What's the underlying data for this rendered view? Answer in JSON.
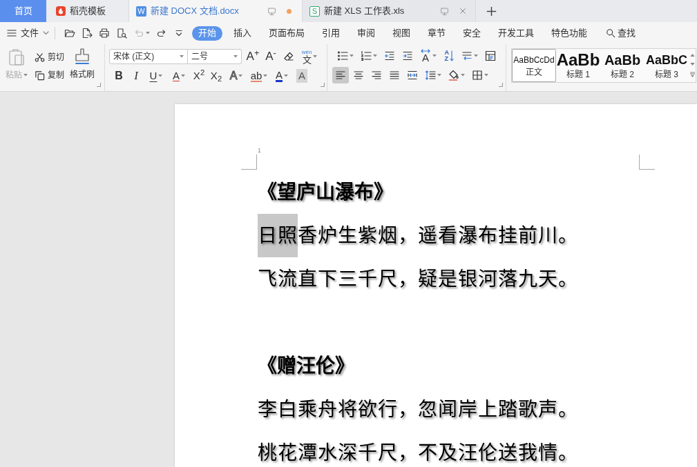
{
  "tabs": [
    {
      "label": "首页",
      "kind": "home",
      "selected": false
    },
    {
      "label": "稻壳模板",
      "kind": "template",
      "selected": false
    },
    {
      "label": "新建 DOCX 文档.docx",
      "kind": "document",
      "badge": "W",
      "selected": true,
      "modified": true
    },
    {
      "label": "新建 XLS 工作表.xls",
      "kind": "sheet",
      "badge": "S",
      "selected": false,
      "modified": false
    }
  ],
  "menu": {
    "file": "文件",
    "quick_access": [
      {
        "kind": "open",
        "disabled": false
      },
      {
        "kind": "pdf",
        "disabled": false
      },
      {
        "kind": "print",
        "disabled": false
      },
      {
        "kind": "preview",
        "disabled": false
      },
      {
        "kind": "undo",
        "disabled": true,
        "dropdown": true
      },
      {
        "kind": "redo",
        "disabled": false
      },
      {
        "kind": "customize",
        "disabled": false
      }
    ],
    "ribbon_tabs": [
      {
        "label": "开始",
        "selected": true
      },
      {
        "label": "插入",
        "selected": false
      },
      {
        "label": "页面布局",
        "selected": false
      },
      {
        "label": "引用",
        "selected": false
      },
      {
        "label": "审阅",
        "selected": false
      },
      {
        "label": "视图",
        "selected": false
      },
      {
        "label": "章节",
        "selected": false
      },
      {
        "label": "安全",
        "selected": false
      },
      {
        "label": "开发工具",
        "selected": false
      },
      {
        "label": "特色功能",
        "selected": false
      }
    ],
    "find": "查找"
  },
  "clipboard": {
    "paste": {
      "label": "粘贴",
      "disabled": true
    },
    "cut": {
      "label": "剪切"
    },
    "copy": {
      "label": "复制"
    },
    "format_painter": {
      "label": "格式刷"
    }
  },
  "font": {
    "family": "宋体 (正文)",
    "size": "二号",
    "row1": [
      {
        "kind": "grow",
        "glyph": "A$^{+}$"
      },
      {
        "kind": "shrink",
        "glyph": "A$^{-}$"
      },
      {
        "kind": "clear"
      },
      {
        "kind": "pinyin",
        "glyph": "文",
        "ruby": "wén",
        "dropdown": true
      }
    ],
    "row2": [
      {
        "kind": "bold",
        "glyph": "B"
      },
      {
        "kind": "italic",
        "glyph": "I"
      },
      {
        "kind": "underline",
        "glyph": "U",
        "dropdown": true
      },
      {
        "kind": "strike",
        "glyph": "A",
        "dropdown": true
      },
      {
        "kind": "superscript",
        "glyph": "X$^{2}$"
      },
      {
        "kind": "subscript",
        "glyph": "X$_{2}$"
      },
      {
        "kind": "effect",
        "glyph": "A",
        "dropdown": true
      },
      {
        "kind": "highlight",
        "glyph": "ab",
        "dropdown": true
      },
      {
        "kind": "color",
        "glyph": "A",
        "dropdown": true
      },
      {
        "kind": "shading",
        "glyph": "A"
      }
    ]
  },
  "paragraph": {
    "row1": [
      {
        "kind": "bullets",
        "dropdown": true
      },
      {
        "kind": "numbering",
        "dropdown": true
      },
      {
        "kind": "outdent"
      },
      {
        "kind": "indent"
      },
      {
        "kind": "direction",
        "glyph": "A",
        "dropdown": true
      },
      {
        "kind": "sort",
        "glyph": "AZ"
      },
      {
        "kind": "layout",
        "dropdown": true
      },
      {
        "kind": "table"
      }
    ],
    "row2": [
      {
        "kind": "align_left",
        "selected": true
      },
      {
        "kind": "align_center",
        "selected": false
      },
      {
        "kind": "align_right",
        "selected": false
      },
      {
        "kind": "justify",
        "selected": false
      },
      {
        "kind": "distribute",
        "selected": false
      },
      {
        "kind": "spacing",
        "dropdown": true,
        "selected": false
      },
      {
        "kind": "shading",
        "dropdown": true,
        "selected": false
      },
      {
        "kind": "borders",
        "dropdown": true,
        "selected": false
      }
    ]
  },
  "styles": [
    {
      "kind": "body",
      "preview": "AaBbCcDd",
      "label": "正文",
      "selected": true
    },
    {
      "kind": "heading1",
      "preview": "AaBb",
      "label": "标题 1",
      "selected": false
    },
    {
      "kind": "heading2",
      "preview": "AaBb",
      "label": "标题 2",
      "selected": false
    },
    {
      "kind": "heading3",
      "preview": "AaBbC",
      "label": "标题 3",
      "selected": false
    }
  ],
  "document": {
    "page_number": "1",
    "paragraphs": [
      {
        "kind": "title",
        "segments": [
          {
            "text": "《望庐山瀑布》",
            "selected": false
          }
        ]
      },
      {
        "kind": "line",
        "segments": [
          {
            "text": "日照",
            "selected": true
          },
          {
            "text": "香炉生紫烟，遥看瀑布挂前川。",
            "selected": false
          }
        ]
      },
      {
        "kind": "line",
        "segments": [
          {
            "text": "飞流直下三千尺，疑是银河落九天。",
            "selected": false
          }
        ]
      },
      {
        "kind": "blank"
      },
      {
        "kind": "title",
        "segments": [
          {
            "text": "《赠汪伦》",
            "selected": false
          }
        ]
      },
      {
        "kind": "line",
        "segments": [
          {
            "text": "李白乘舟将欲行，忽闻岸上踏歌声。",
            "selected": false
          }
        ]
      },
      {
        "kind": "line",
        "segments": [
          {
            "text": "桃花潭水深千尺，不及汪伦送我情。",
            "selected": false
          }
        ]
      }
    ]
  }
}
